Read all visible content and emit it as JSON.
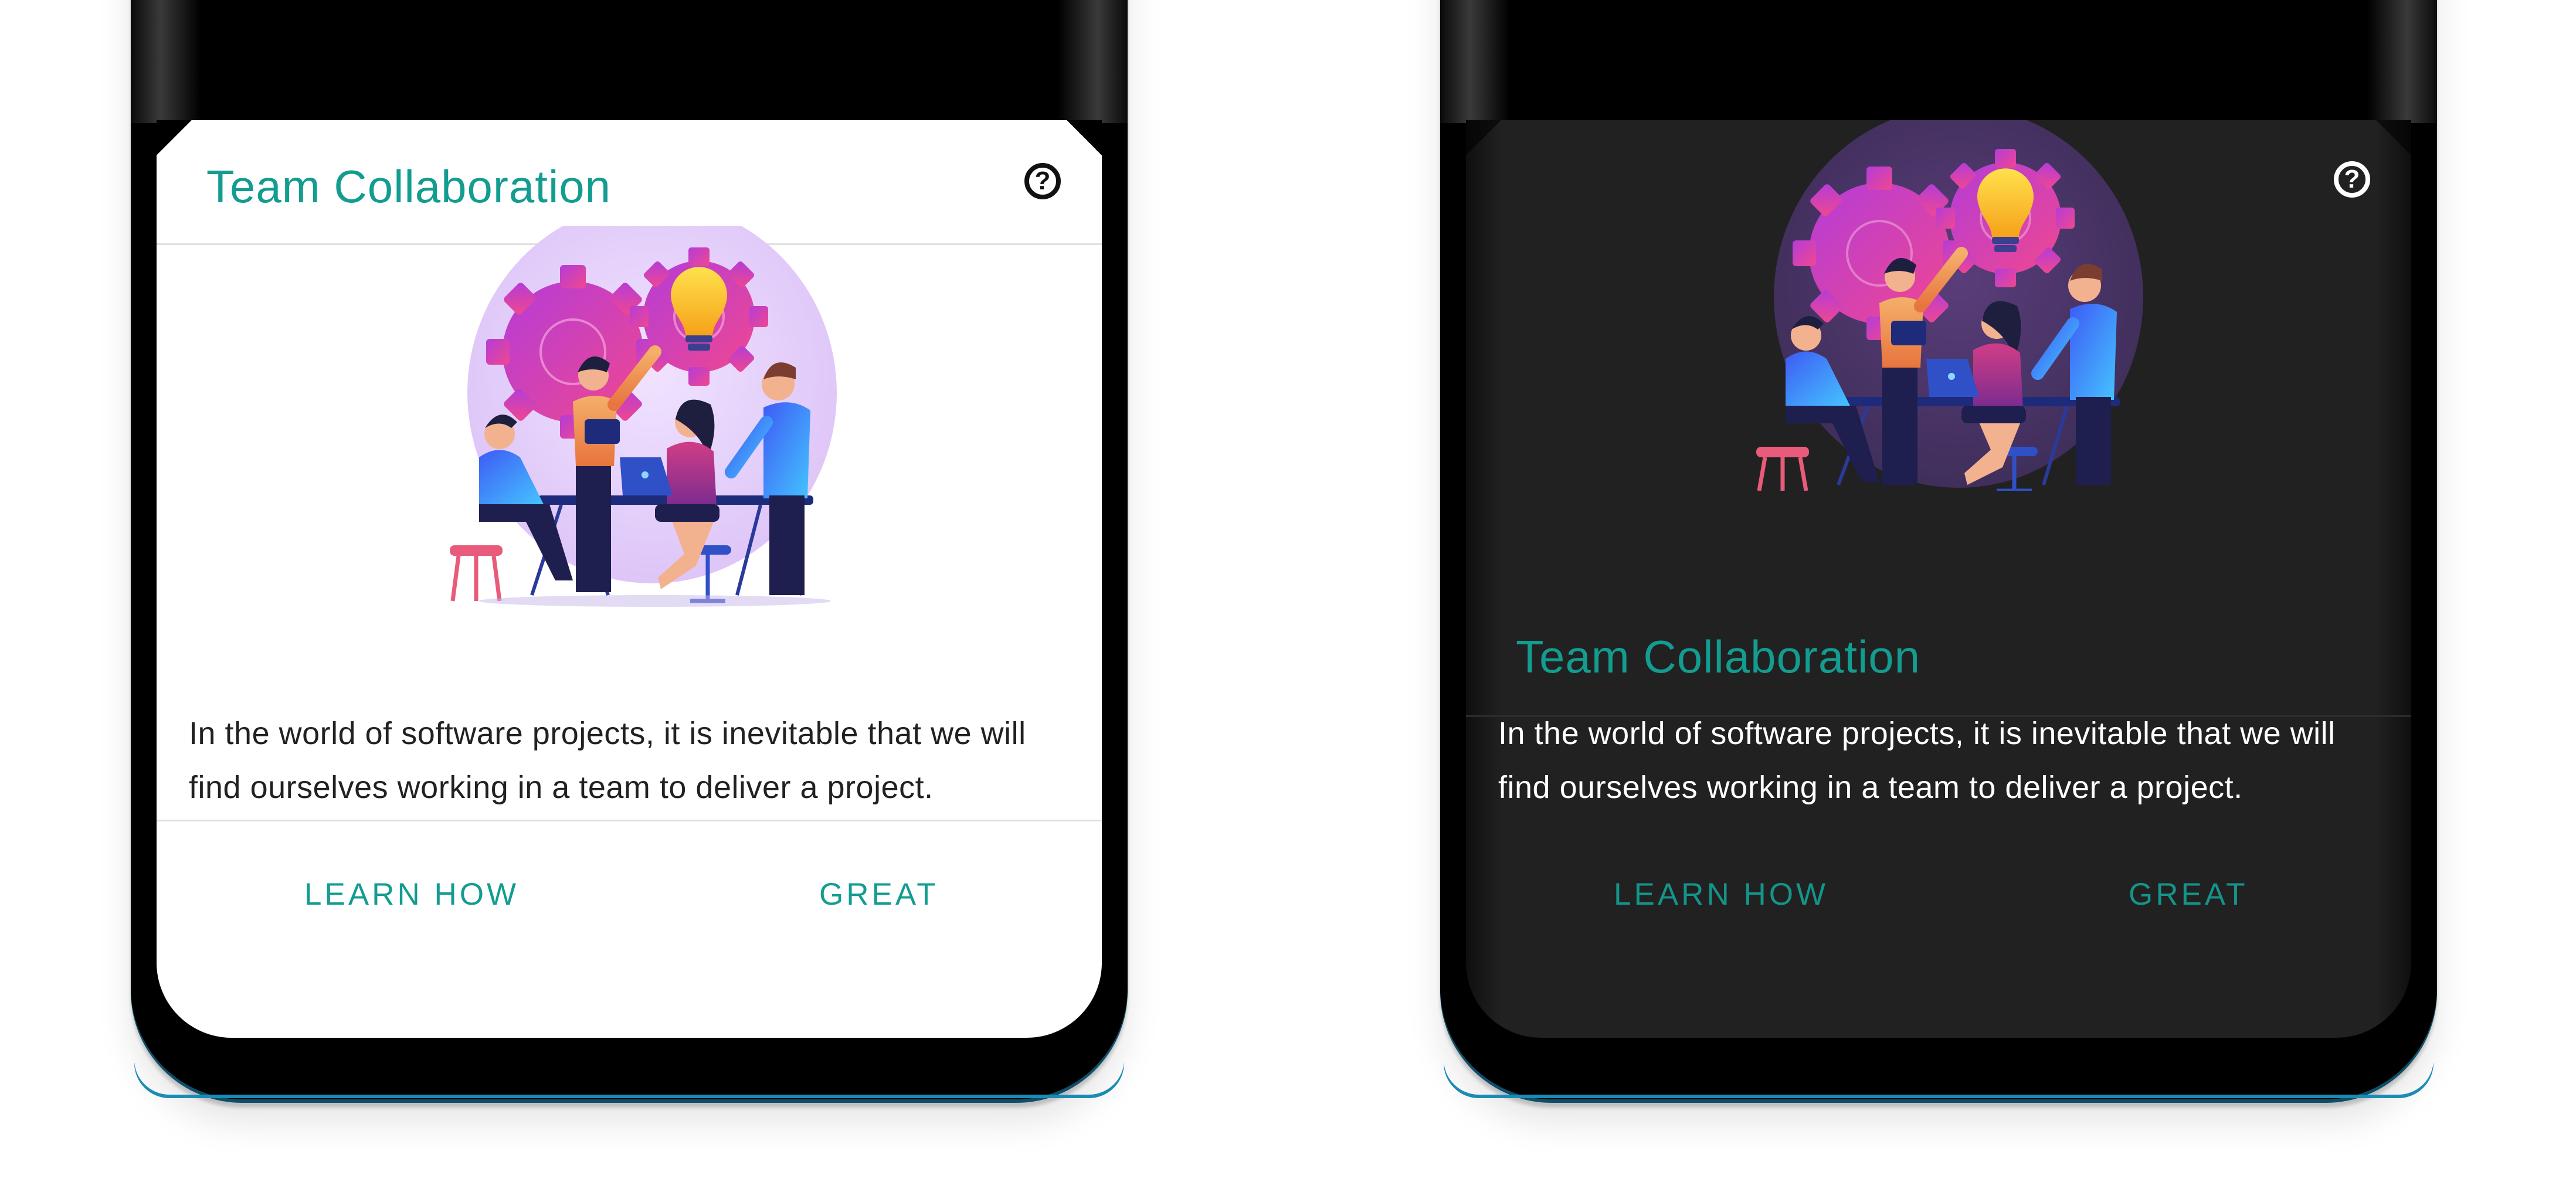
{
  "cards": [
    {
      "theme": "light",
      "title": "Team Collaboration",
      "help_icon": "help-circle-icon",
      "help_glyph": "?",
      "illustration": "team-collaboration-illustration",
      "body": "In the world of software projects, it is inevitable that we will find ourselves working in a team to deliver a project.",
      "actions": {
        "learn": "LEARN HOW",
        "great": "GREAT"
      }
    },
    {
      "theme": "dark",
      "title": "Team Collaboration",
      "help_icon": "help-circle-icon",
      "help_glyph": "?",
      "illustration": "team-collaboration-illustration",
      "body": "In the world of software projects, it is inevitable that we will find ourselves working in a team to deliver a project.",
      "actions": {
        "learn": "LEARN HOW",
        "great": "GREAT"
      }
    }
  ],
  "colors": {
    "accent": "#139c90",
    "light_surface": "#ffffff",
    "dark_surface": "#212121",
    "bezel": "#000000",
    "frame_edge": "#1a8bb5"
  }
}
